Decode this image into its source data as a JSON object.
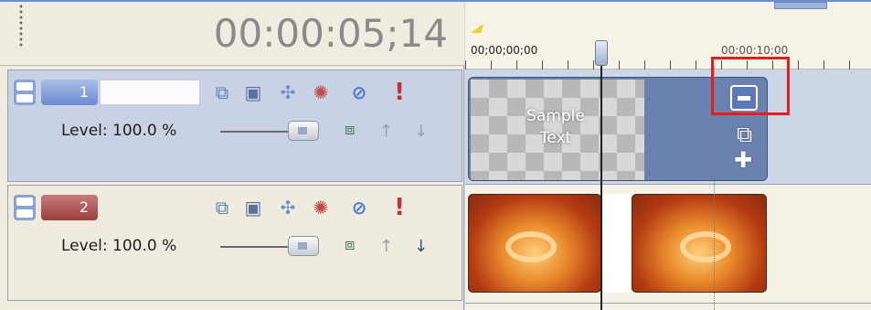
{
  "header": {
    "timecode": "00:00:05;14"
  },
  "ruler": {
    "label_start": "00;00;00;00",
    "label_end": "00:00:10;00"
  },
  "tracks": [
    {
      "number": "1",
      "name": "",
      "level": "Level: 100.0 %",
      "level_value": 1.0
    },
    {
      "number": "2",
      "name": "",
      "level": "Level: 100.0 %",
      "level_value": 1.0
    }
  ],
  "clips": {
    "text_clip_label_1": "Sample",
    "text_clip_label_2": "Text"
  },
  "icons": {
    "track_tools": [
      "mask-icon",
      "compositing-icon",
      "track-motion-icon",
      "track-fx-icon",
      "mute-icon",
      "solo-icon"
    ],
    "clip_handles": [
      "collapse-icon",
      "crop-icon",
      "pan-icon"
    ]
  },
  "colors": {
    "highlight": "#e21e1e",
    "track1": "#6b8ad0",
    "track2": "#9c3f3f"
  }
}
